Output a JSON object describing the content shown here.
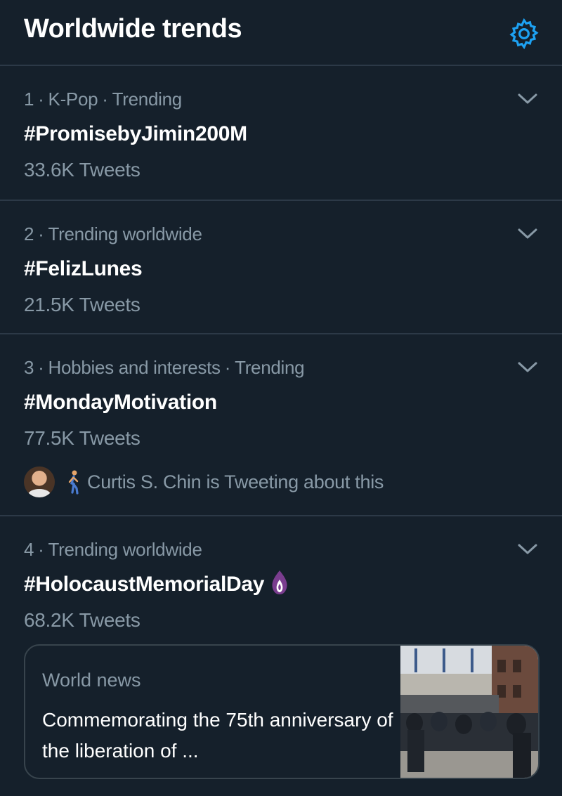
{
  "header": {
    "title": "Worldwide trends",
    "settings_icon": "gear-icon"
  },
  "colors": {
    "background": "#15202b",
    "divider": "#2c3947",
    "secondary_text": "#8899a6",
    "accent": "#1da1f2",
    "candle": "#7a3d8f"
  },
  "trends": [
    {
      "rank": "1",
      "context": [
        "K-Pop",
        "Trending"
      ],
      "name": "#PromisebyJimin200M",
      "count": "33.6K Tweets"
    },
    {
      "rank": "2",
      "context": [
        "Trending worldwide"
      ],
      "name": "#FelizLunes",
      "count": "21.5K Tweets"
    },
    {
      "rank": "3",
      "context": [
        "Hobbies and interests",
        "Trending"
      ],
      "name": "#MondayMotivation",
      "count": "77.5K Tweets",
      "tweeting": {
        "avatar": "avatar",
        "icon": "person-walking-icon",
        "text": "Curtis S. Chin is Tweeting about this"
      }
    },
    {
      "rank": "4",
      "context": [
        "Trending worldwide"
      ],
      "name": "#HolocaustMemorialDay",
      "name_icon": "candle-icon",
      "count": "68.2K Tweets",
      "news": {
        "category": "World news",
        "headline": "Commemorating the 75th anniversary of the liberation of ..."
      }
    }
  ],
  "separator": "·"
}
